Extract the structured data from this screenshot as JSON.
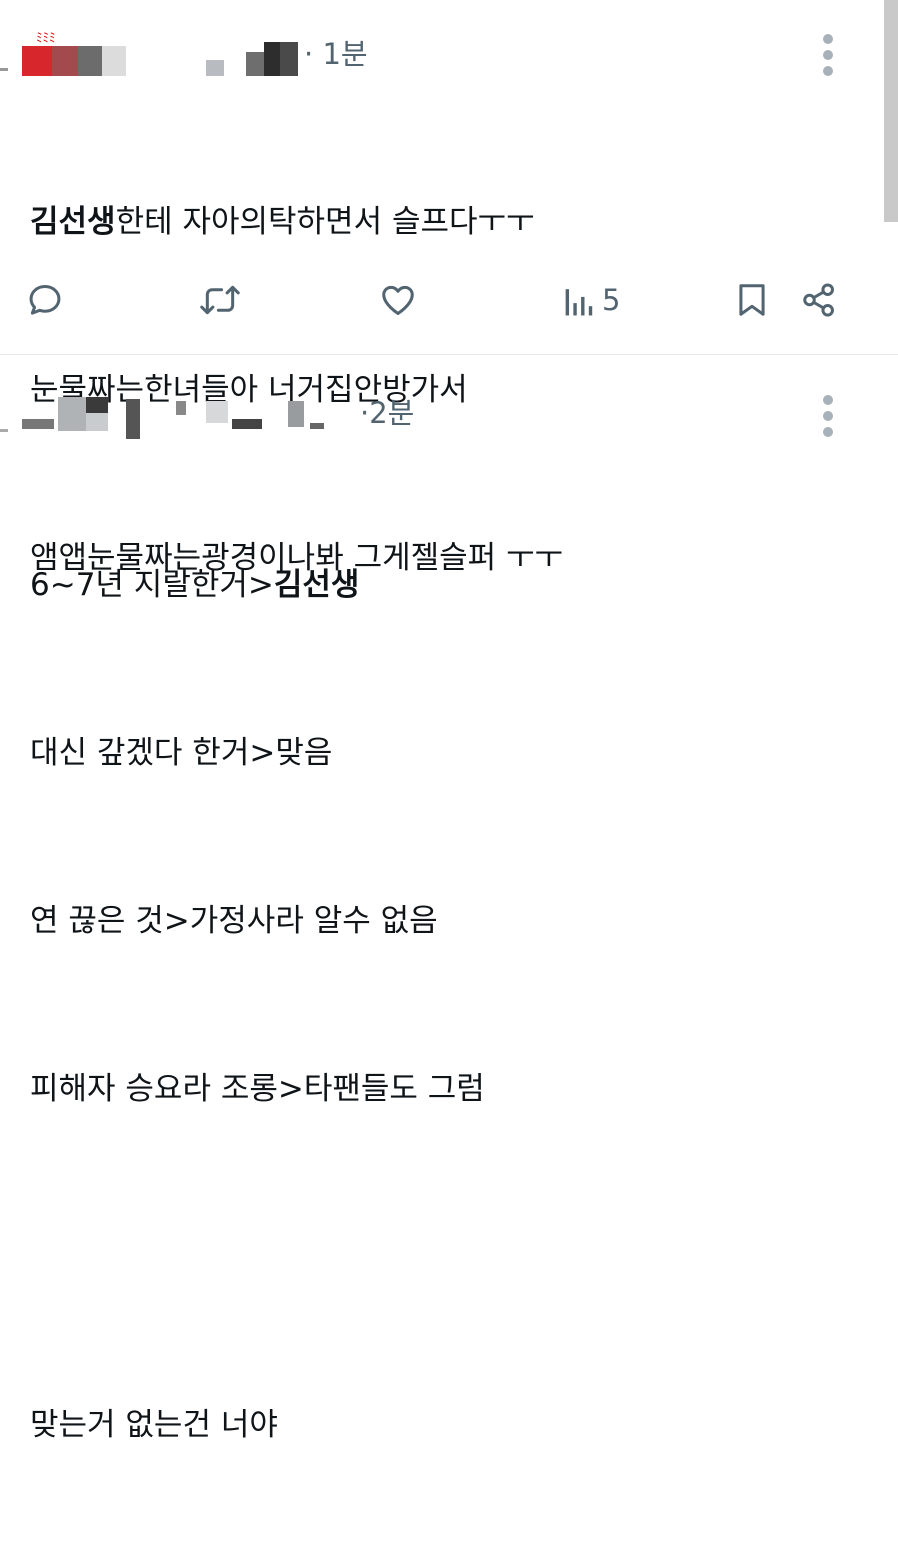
{
  "tweet1": {
    "time_sep": "·",
    "time": "1분",
    "lines": [
      {
        "bold": "김선생",
        "rest": "한테 자아의탁하면서 슬프다ㅜㅜ"
      },
      {
        "bold": "",
        "rest": "눈물짜는한녀들아 너거집안방가서"
      },
      {
        "bold": "",
        "rest": "앰앱눈물짜는광경이나봐 그게젤슬퍼 ㅜㅜ"
      }
    ],
    "views_count": "5"
  },
  "tweet2": {
    "time_sep": "·",
    "time": "2분",
    "lines": [
      {
        "pre": "6~7년 지랄한거>",
        "bold": "김선생"
      },
      {
        "pre": "대신 갚겠다 한거>맞음",
        "bold": ""
      },
      {
        "pre": "연 끊은 것>가정사라 알수 없음",
        "bold": ""
      },
      {
        "pre": "피해자 승요라 조롱>타팬들도 그럼",
        "bold": ""
      },
      {
        "pre": "",
        "bold": ""
      },
      {
        "pre": "맞는거 없는건 너야",
        "bold": ""
      }
    ]
  },
  "colors": {
    "text": "#0f1419",
    "muted": "#536471",
    "divider": "#e6e9ec",
    "more_dots": "#a7b1ba"
  },
  "icons": [
    "reply-icon",
    "retweet-icon",
    "like-icon",
    "views-icon",
    "bookmark-icon",
    "share-icon",
    "more-icon"
  ]
}
